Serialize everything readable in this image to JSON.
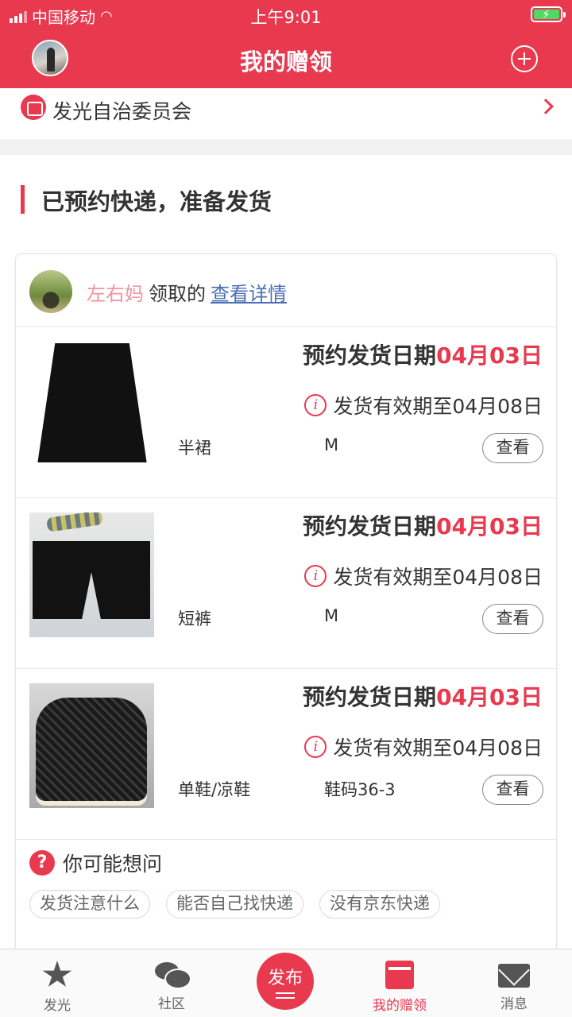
{
  "status": {
    "carrier": "中国移动",
    "time": "上午9:01"
  },
  "header": {
    "title": "我的赠领"
  },
  "committee": {
    "name": "发光自治委员会"
  },
  "section": {
    "title": "已预约快递，准备发货"
  },
  "claimer": {
    "username": "左右妈",
    "verb": "领取的",
    "detail_link": "查看详情"
  },
  "items": [
    {
      "date_label": "预约发货日期",
      "date_value": "04月03日",
      "valid_text": "发货有效期至04月08日",
      "category": "半裙",
      "size": "M",
      "view_label": "查看"
    },
    {
      "date_label": "预约发货日期",
      "date_value": "04月03日",
      "valid_text": "发货有效期至04月08日",
      "category": "短裤",
      "size": "M",
      "view_label": "查看"
    },
    {
      "date_label": "预约发货日期",
      "date_value": "04月03日",
      "valid_text": "发货有效期至04月08日",
      "category": "单鞋/凉鞋",
      "size": "鞋码36-3",
      "view_label": "查看"
    }
  ],
  "faq": {
    "title": "你可能想问",
    "tags": [
      "发货注意什么",
      "能否自己找快递",
      "没有京东快递"
    ]
  },
  "tabbar": {
    "tabs": [
      {
        "label": "发光",
        "icon": "star-icon"
      },
      {
        "label": "社区",
        "icon": "chat-bubble-icon"
      },
      {
        "label": "发布",
        "icon": "publish-icon"
      },
      {
        "label": "我的赠领",
        "icon": "gift-icon"
      },
      {
        "label": "消息",
        "icon": "mail-icon"
      }
    ]
  },
  "colors": {
    "brand": "#e8394f",
    "link": "#4a6fb5",
    "username": "#f0939e"
  }
}
